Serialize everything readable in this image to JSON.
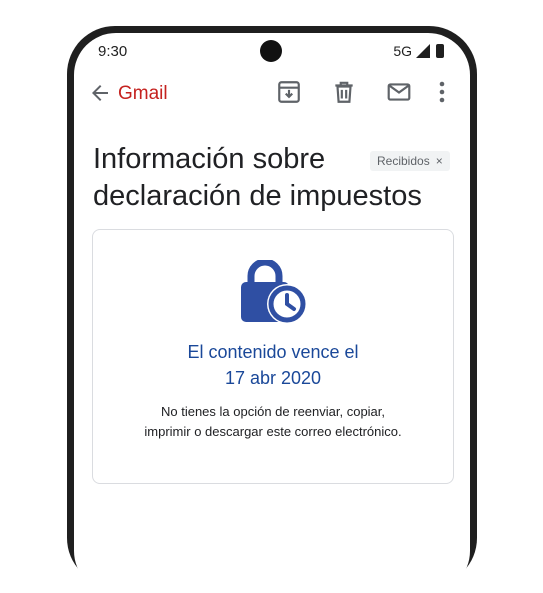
{
  "status_bar": {
    "time": "9:30",
    "network": "5G"
  },
  "app_bar": {
    "title": "Gmail"
  },
  "email": {
    "subject_line1": "Información sobre",
    "subject_line2": "declaración de impuestos",
    "label": "Recibidos",
    "label_close": "×"
  },
  "confidential_card": {
    "expire_line1": "El contenido vence el",
    "expire_line2": "17 abr 2020",
    "note_line1": "No tienes la opción de reenviar, copiar,",
    "note_line2": "imprimir o descargar este correo electrónico."
  },
  "icons": [
    "back-arrow-icon",
    "archive-icon",
    "trash-icon",
    "mail-icon",
    "more-vert-icon",
    "lock-clock-icon",
    "signal-icon",
    "battery-icon"
  ],
  "colors": {
    "gmail_red": "#c5221f",
    "lock_blue": "#2f4fa3",
    "expire_text": "#1a4899"
  }
}
